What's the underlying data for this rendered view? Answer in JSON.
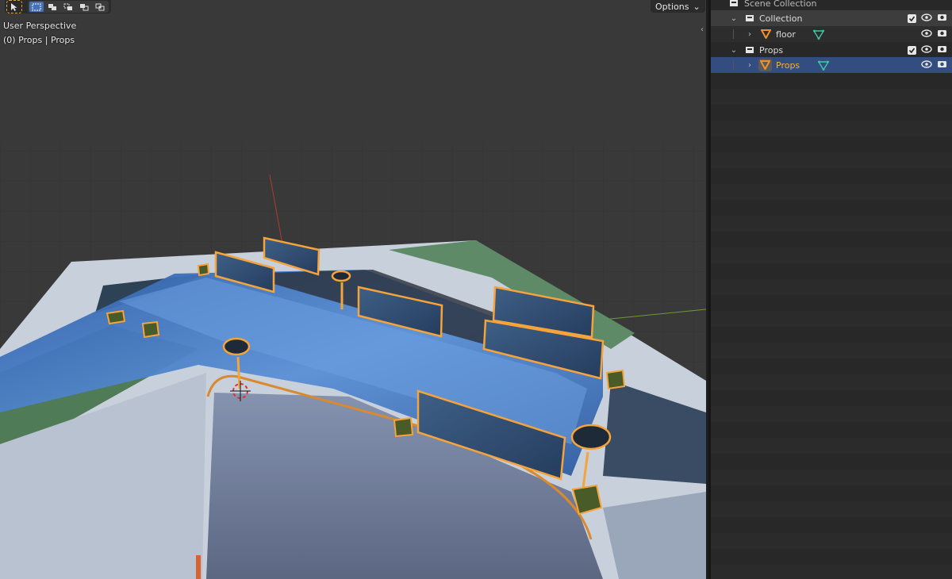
{
  "viewport": {
    "view_name": "User Perspective",
    "selection_info": "(0) Props | Props",
    "options_label": "Options",
    "toolbar": {
      "select_tool": "select-cursor-icon",
      "modes": [
        "select-box-new-icon",
        "select-box-extend-icon",
        "select-box-subtract-icon",
        "select-box-invert-icon",
        "select-box-intersect-icon"
      ]
    },
    "colors": {
      "selection_outline": "#f5a33b",
      "grid_bg": "#3a3a3a",
      "x_axis": "#c0392b",
      "y_axis": "#7fae3a"
    }
  },
  "outliner": {
    "header_label": "Scene Collection",
    "items": [
      {
        "label": "Collection",
        "type": "collection",
        "expanded": true,
        "checked": true
      },
      {
        "label": "floor",
        "type": "object",
        "expanded": false
      },
      {
        "label": "Props",
        "type": "collection",
        "expanded": true,
        "checked": true
      },
      {
        "label": "Props",
        "type": "object",
        "expanded": false,
        "selected": true
      }
    ],
    "colors": {
      "selected_row": "#334d80",
      "selected_text": "#ffaf29",
      "mesh_icon": "#3ec7a4",
      "object_icon": "#f0922e"
    }
  }
}
